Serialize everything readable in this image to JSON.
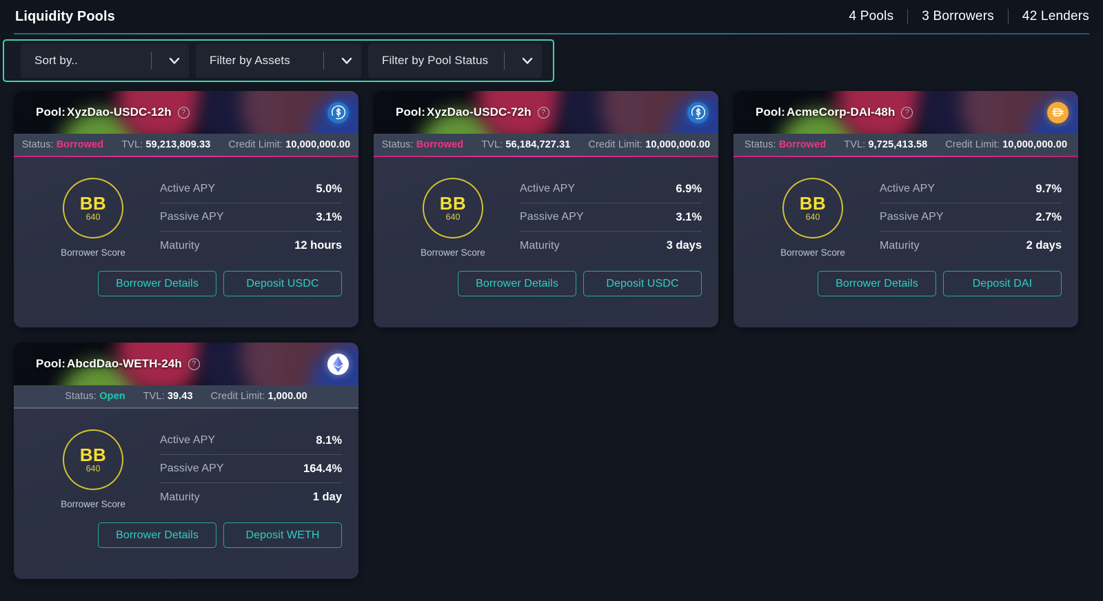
{
  "header": {
    "title": "Liquidity Pools",
    "stats": [
      {
        "label": "4 Pools"
      },
      {
        "label": "3 Borrowers"
      },
      {
        "label": "42 Lenders"
      }
    ]
  },
  "filters": {
    "sort": {
      "label": "Sort by..",
      "icon": "chevron-down-icon"
    },
    "assets": {
      "label": "Filter by Assets",
      "icon": "chevron-down-icon"
    },
    "status": {
      "label": "Filter by Pool Status",
      "icon": "chevron-down-icon"
    },
    "highlight_color": "#3fd3ae"
  },
  "labels": {
    "pool_prefix": "Pool: ",
    "status": "Status: ",
    "tvl": "TVL: ",
    "credit_limit": "Credit Limit: ",
    "active_apy": "Active APY",
    "passive_apy": "Passive APY",
    "maturity": "Maturity",
    "borrower_score": "Borrower Score",
    "help": "?"
  },
  "colors": {
    "status_borrowed": "#f0338a",
    "status_open": "#1ec9b0",
    "accent_teal": "#31cfc4",
    "score_yellow": "#f5e031"
  },
  "cards": [
    {
      "pool_name": "XyzDao-USDC-12h",
      "status": "Borrowed",
      "status_kind": "borrowed",
      "tvl": "59,213,809.33",
      "credit_limit": "10,000,000.00",
      "coin_icon": "usdc-icon",
      "score_grade": "BB",
      "score_value": "640",
      "active_apy": "5.0%",
      "passive_apy": "3.1%",
      "maturity": "12 hours",
      "btn_details": "Borrower Details",
      "btn_deposit": "Deposit USDC"
    },
    {
      "pool_name": "XyzDao-USDC-72h",
      "status": "Borrowed",
      "status_kind": "borrowed",
      "tvl": "56,184,727.31",
      "credit_limit": "10,000,000.00",
      "coin_icon": "usdc-icon",
      "score_grade": "BB",
      "score_value": "640",
      "active_apy": "6.9%",
      "passive_apy": "3.1%",
      "maturity": "3 days",
      "btn_details": "Borrower Details",
      "btn_deposit": "Deposit USDC"
    },
    {
      "pool_name": "AcmeCorp-DAI-48h",
      "status": "Borrowed",
      "status_kind": "borrowed",
      "tvl": "9,725,413.58",
      "credit_limit": "10,000,000.00",
      "coin_icon": "dai-icon",
      "score_grade": "BB",
      "score_value": "640",
      "active_apy": "9.7%",
      "passive_apy": "2.7%",
      "maturity": "2 days",
      "btn_details": "Borrower Details",
      "btn_deposit": "Deposit DAI"
    },
    {
      "pool_name": "AbcdDao-WETH-24h",
      "status": "Open",
      "status_kind": "open",
      "tvl": "39.43",
      "credit_limit": "1,000.00",
      "coin_icon": "eth-icon",
      "score_grade": "BB",
      "score_value": "640",
      "active_apy": "8.1%",
      "passive_apy": "164.4%",
      "maturity": "1 day",
      "btn_details": "Borrower Details",
      "btn_deposit": "Deposit WETH"
    }
  ]
}
